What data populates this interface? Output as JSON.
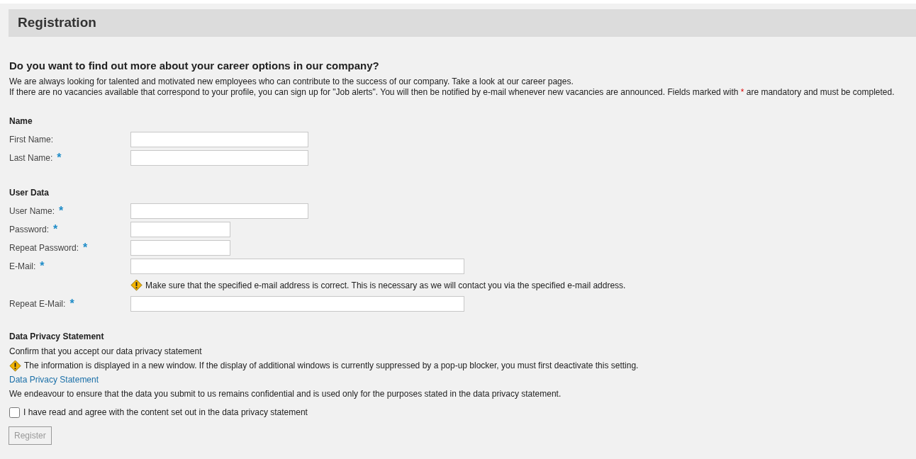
{
  "header": {
    "title": "Registration"
  },
  "intro": {
    "heading": "Do you want to find out more about your career options in our company?",
    "line_1": "We are always looking for talented and motivated new employees who can contribute to the success of our company. Take a look at our career pages.",
    "line_2_before": "If there are no vacancies available that correspond to your profile, you can sign up for \"Job alerts\". You will then be notified by e-mail whenever new vacancies are announced. Fields marked with ",
    "line_2_mark": "*",
    "line_2_after": " are mandatory and must be completed."
  },
  "sections": [
    {
      "title": "Name",
      "fields": [
        {
          "label": "First Name:",
          "required": false,
          "kind": "text"
        },
        {
          "label": "Last Name:",
          "required": true,
          "kind": "text"
        }
      ]
    },
    {
      "title": "User Data",
      "fields": [
        {
          "label": "User Name:",
          "required": true,
          "kind": "text"
        },
        {
          "label": "Password:",
          "required": true,
          "kind": "password"
        },
        {
          "label": "Repeat Password:",
          "required": true,
          "kind": "password"
        },
        {
          "label": "E-Mail:",
          "required": true,
          "kind": "email",
          "note": "Make sure that the specified e-mail address is correct. This is necessary as we will contact you via the specified e-mail address."
        },
        {
          "label": "Repeat E-Mail:",
          "required": true,
          "kind": "email"
        }
      ]
    }
  ],
  "privacy": {
    "title": "Data Privacy Statement",
    "confirm": "Confirm that you accept our data privacy statement",
    "warning": "The information is displayed in a new window. If the display of additional windows is currently suppressed by a pop-up blocker, you must first deactivate this setting.",
    "link": "Data Privacy Statement",
    "text": "We endeavour to ensure that the data you submit to us remains confidential and is used only for the purposes stated in the data privacy statement.",
    "agree": {
      "label": "I have read and agree with the content set out in the data privacy statement",
      "checked": false
    }
  },
  "register_button": {
    "label": "Register",
    "disabled": true
  }
}
